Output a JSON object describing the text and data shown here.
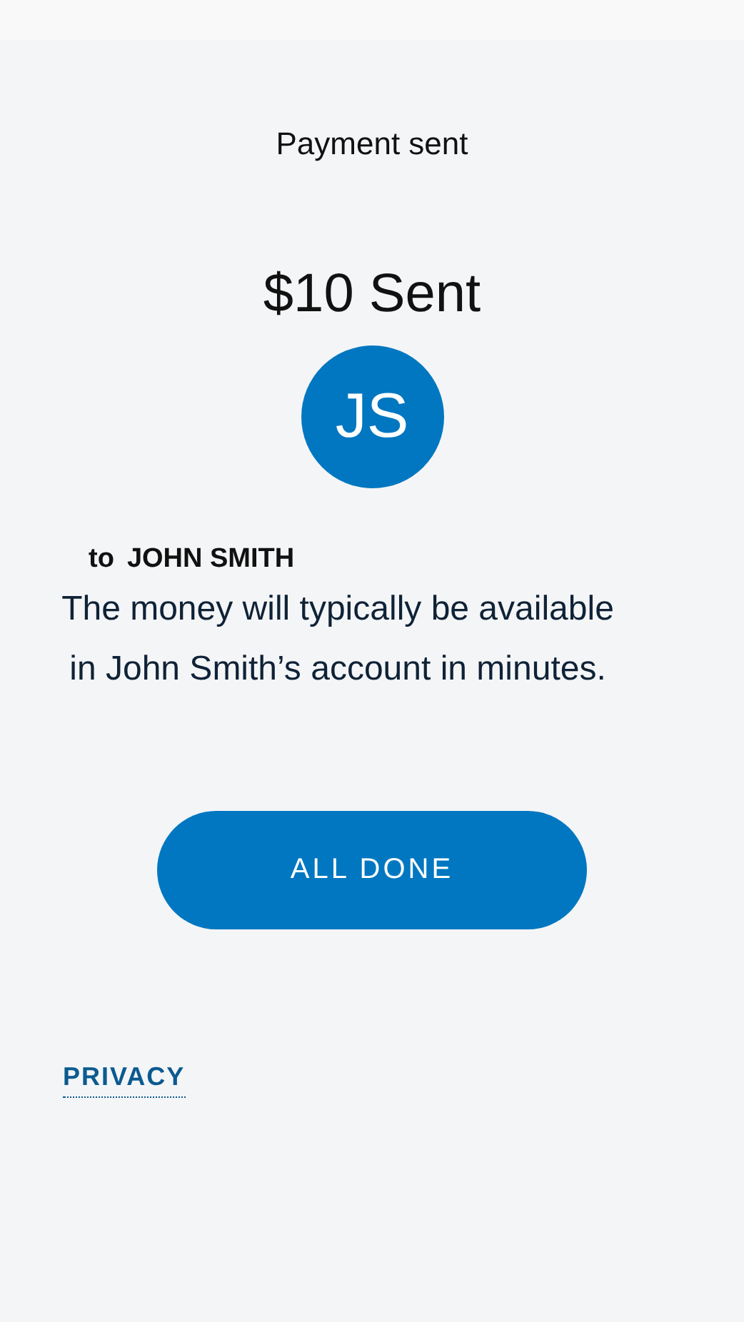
{
  "header": {
    "title": "Payment sent"
  },
  "amount": "$10 Sent",
  "recipient": {
    "initials": "JS",
    "prefix": "to",
    "name": "JOHN SMITH"
  },
  "message": "The money will typically be available in John Smith’s account in minutes.",
  "buttons": [
    {
      "label": "ALL DONE"
    }
  ],
  "footer": {
    "link": "PRIVACY"
  }
}
